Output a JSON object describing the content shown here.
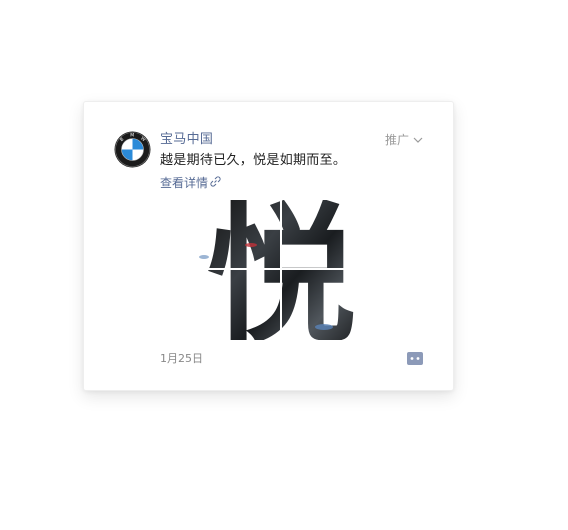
{
  "post": {
    "account_name": "宝马中国",
    "sponsored_label": "推广",
    "message": "越是期待已久，悦是如期而至。",
    "details_link": "查看详情",
    "image_character": "悦",
    "date": "1月25日"
  },
  "icons": {
    "avatar": "bmw-logo-icon",
    "sponsored_dropdown": "chevron-down-icon",
    "details_link": "link-icon",
    "comment": "comment-icon"
  },
  "colors": {
    "link": "#576b95",
    "text": "#222222",
    "muted": "#9a9a9a",
    "bmw_blue": "#2b8ad8"
  }
}
